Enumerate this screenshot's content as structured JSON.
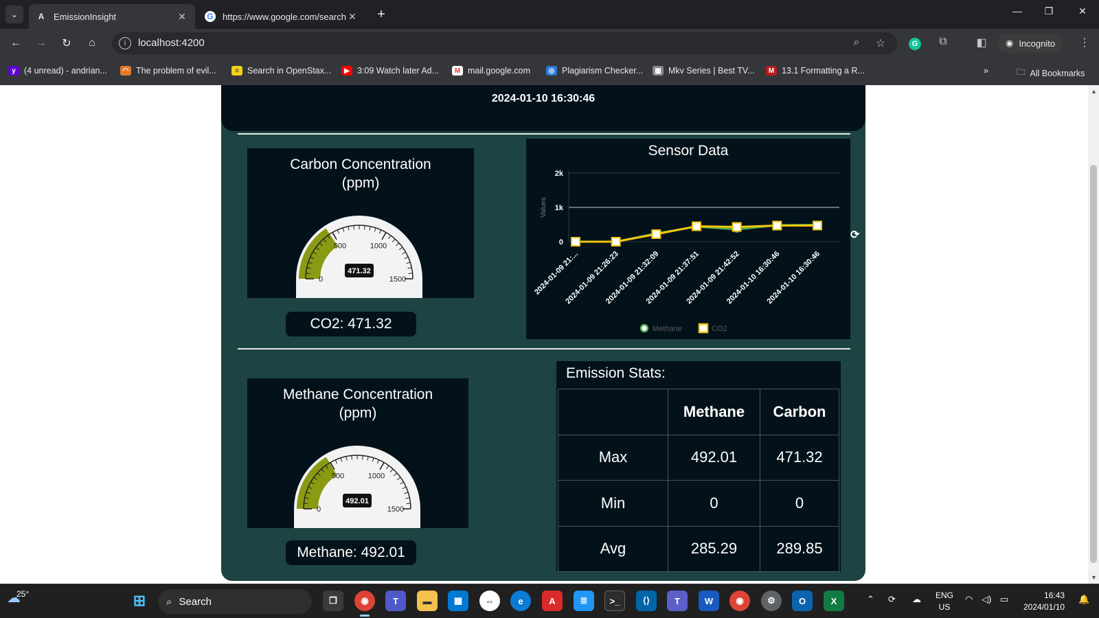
{
  "browser": {
    "tabs": [
      {
        "title": "EmissionInsight",
        "icon": "angular-icon",
        "active": true
      },
      {
        "title": "https://www.google.com/search",
        "icon": "google-icon",
        "active": false
      }
    ],
    "url": "localhost:4200",
    "incognito_label": "Incognito",
    "bookmarks": [
      {
        "label": "(4 unread) - andrian...",
        "icon": "yahoo-mail-icon",
        "color": "#6001d2"
      },
      {
        "label": "The problem of evil...",
        "icon": "rainbow-icon",
        "color": "#e07a2c"
      },
      {
        "label": "Search in OpenStax...",
        "icon": "openstax-icon",
        "color": "#f4d019"
      },
      {
        "label": "3:09 Watch later Ad...",
        "icon": "youtube-icon",
        "color": "#ff0000"
      },
      {
        "label": "mail.google.com",
        "icon": "gmail-icon",
        "color": "#ea4335"
      },
      {
        "label": "Plagiarism Checker...",
        "icon": "plagiarism-icon",
        "color": "#2b7bd6"
      },
      {
        "label": "Mkv Series | Best TV...",
        "icon": "mkv-icon",
        "color": "#888888"
      },
      {
        "label": "13.1 Formatting a R...",
        "icon": "formatting-icon",
        "color": "#b71c1c"
      }
    ],
    "all_bookmarks_label": "All Bookmarks"
  },
  "dashboard": {
    "timestamp": "2024-01-10 16:30:46",
    "carbon_gauge": {
      "title_line1": "Carbon Concentration",
      "title_line2": "(ppm)",
      "value": 471.32,
      "value_label": "471.32",
      "min": 0,
      "max": 1500,
      "ticks": [
        "0",
        "500",
        "1000",
        "1500"
      ],
      "readout": "CO2: 471.32"
    },
    "methane_gauge": {
      "title_line1": "Methane Concentration",
      "title_line2": "(ppm)",
      "value": 492.01,
      "value_label": "492.01",
      "min": 0,
      "max": 1500,
      "ticks": [
        "0",
        "500",
        "1000",
        "1500"
      ],
      "readout": "Methane: 492.01"
    },
    "stats": {
      "title": "Emission Stats:",
      "headers": [
        "",
        "Methane",
        "Carbon"
      ],
      "rows": [
        {
          "label": "Max",
          "methane": "492.01",
          "carbon": "471.32"
        },
        {
          "label": "Min",
          "methane": "0",
          "carbon": "0"
        },
        {
          "label": "Avg",
          "methane": "285.29",
          "carbon": "289.85"
        }
      ]
    },
    "colors": {
      "panel": "#03121a",
      "background": "#1d4342",
      "gauge_fill": "#8a9a12",
      "methane_line": "#4caf50",
      "co2_line": "#f2c40f"
    }
  },
  "chart_data": {
    "type": "line",
    "title": "Sensor Data",
    "ylabel": "Values",
    "xlabel": "",
    "categories": [
      "2024-01-09 21:...",
      "2024-01-09 21:26:23",
      "2024-01-09 21:32:09",
      "2024-01-09 21:37:51",
      "2024-01-09 21:42:52",
      "2024-01-10 16:30:46",
      "2024-01-10 16:30:46"
    ],
    "yticks": [
      "0",
      "1k",
      "2k"
    ],
    "ylim": [
      0,
      2000
    ],
    "series": [
      {
        "name": "Methane",
        "values": [
          0,
          0,
          240,
          440,
          360,
          480,
          492
        ]
      },
      {
        "name": "CO2",
        "values": [
          0,
          0,
          220,
          450,
          430,
          470,
          471
        ]
      }
    ],
    "legend": "bottom"
  },
  "taskbar": {
    "weather_temp": "25°",
    "search_label": "Search",
    "lang_line1": "ENG",
    "lang_line2": "US",
    "time": "16:43",
    "date": "2024/01/10"
  }
}
